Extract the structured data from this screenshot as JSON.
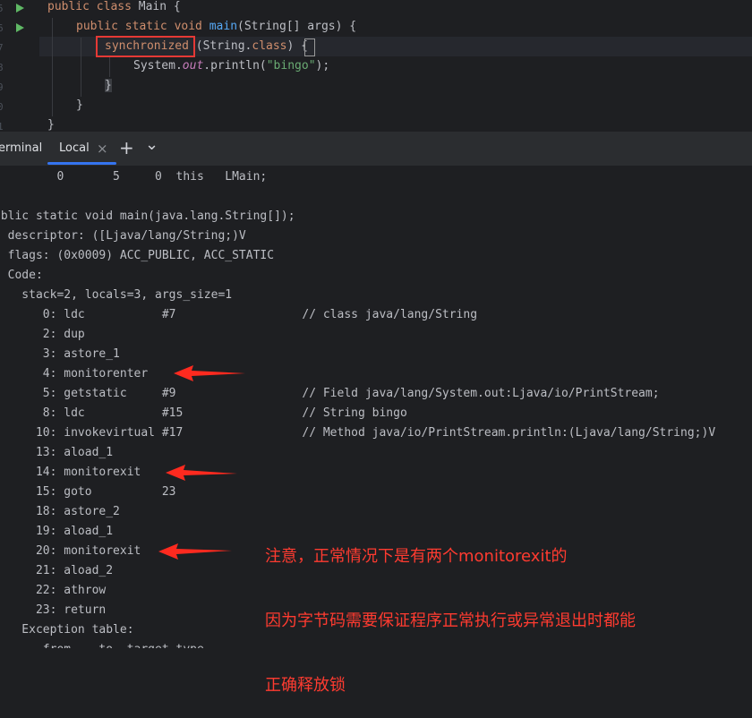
{
  "editor": {
    "gutter": [
      "5",
      "6",
      "7",
      "8",
      "9",
      "0",
      "1"
    ],
    "line1": {
      "kw1": "public class",
      "rest": " Main {"
    },
    "line2": {
      "kw": "public static void ",
      "fn": "main",
      "rest": "(String[] args) {"
    },
    "line3": {
      "kw": "synchronized",
      "mid": " (String.",
      "kw2": "class",
      "end": ") {"
    },
    "line4": {
      "a": "System.",
      "b": "out",
      "c": ".println(",
      "d": "\"bingo\"",
      "e": ");"
    },
    "line5": "}",
    "line6": "}",
    "line7": "}"
  },
  "terminal": {
    "tab_title": "erminal",
    "local_tab": "Local",
    "close_glyph": "×",
    "add_glyph": "+",
    "dropdown_glyph": "⌄",
    "lines": [
      "         0       5     0  this   LMain;",
      "",
      "ublic static void main(java.lang.String[]);",
      "  descriptor: ([Ljava/lang/String;)V",
      "  flags: (0x0009) ACC_PUBLIC, ACC_STATIC",
      "  Code:",
      "    stack=2, locals=3, args_size=1",
      "       0: ldc           #7                  // class java/lang/String",
      "       2: dup",
      "       3: astore_1",
      "       4: monitorenter",
      "       5: getstatic     #9                  // Field java/lang/System.out:Ljava/io/PrintStream;",
      "       8: ldc           #15                 // String bingo",
      "      10: invokevirtual #17                 // Method java/io/PrintStream.println:(Ljava/lang/String;)V",
      "      13: aload_1",
      "      14: monitorexit",
      "      15: goto          23",
      "      18: astore_2",
      "      19: aload_1",
      "      20: monitorexit",
      "      21: aload_2",
      "      22: athrow",
      "      23: return",
      "    Exception table:",
      "       from    to  target type"
    ]
  },
  "annotation": {
    "lines": [
      "注意，正常情况下是有两个monitorexit的",
      "因为字节码需要保证程序正常执行或异常退出时都能",
      "正确释放锁"
    ],
    "color": "#ff3b30"
  },
  "colors": {
    "background": "#1e1f22",
    "keyword": "#cf8e6d",
    "function": "#56a8f5",
    "string": "#6aab73",
    "run_icon": "#5fb865"
  }
}
